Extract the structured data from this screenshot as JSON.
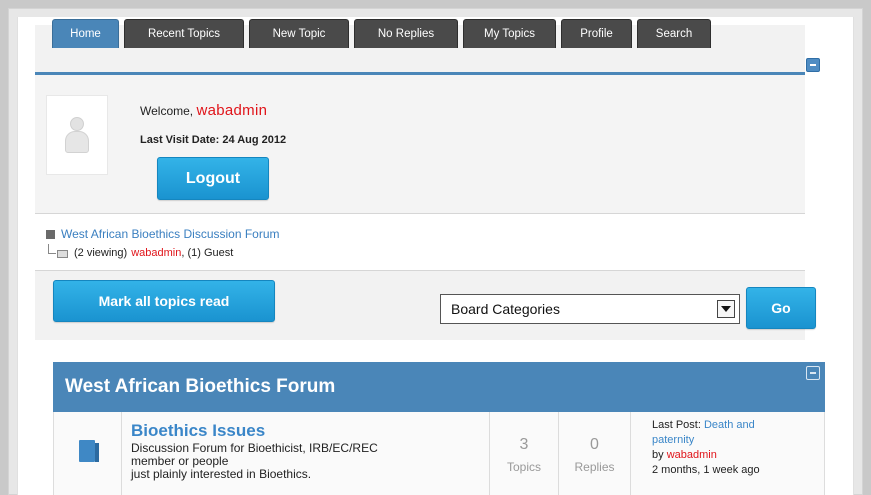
{
  "tabs": [
    {
      "label": "Home",
      "active": true
    },
    {
      "label": "Recent Topics",
      "active": false
    },
    {
      "label": "New Topic",
      "active": false
    },
    {
      "label": "No Replies",
      "active": false
    },
    {
      "label": "My Topics",
      "active": false
    },
    {
      "label": "Profile",
      "active": false
    },
    {
      "label": "Search",
      "active": false
    }
  ],
  "welcome": {
    "greeting": "Welcome,",
    "username": "wabadmin",
    "last_visit_label": "Last Visit Date:",
    "last_visit_value": "24 Aug 2012",
    "logout_label": "Logout"
  },
  "whos_online": {
    "forum_name": "West African Bioethics Discussion Forum",
    "viewing_count": "(2 viewing)",
    "viewer": "wabadmin",
    "guests": ", (1) Guest"
  },
  "actions": {
    "mark_read_label": "Mark all topics read",
    "category_selected": "Board Categories",
    "go_label": "Go"
  },
  "section": {
    "title": "West African Bioethics Forum",
    "forum": {
      "title": "Bioethics Issues",
      "description_lines": [
        "Discussion Forum for Bioethicist, IRB/EC/REC",
        "member or people",
        "just plainly interested in Bioethics."
      ],
      "topics_count": "3",
      "topics_label": "Topics",
      "replies_count": "0",
      "replies_label": "Replies",
      "last_post_label": "Last Post:",
      "last_post_title_lines": [
        "Death and",
        "paternity"
      ],
      "last_post_by_label": "by",
      "last_post_author": "wabadmin",
      "last_post_time": "2 months, 1 week ago"
    }
  },
  "colors": {
    "tab_active": "#4a86b8",
    "tab_inactive": "#4a4a4a",
    "button": "#1a93d0",
    "header": "#4a86b8",
    "username": "#e0141a",
    "link": "#3a86c8"
  }
}
